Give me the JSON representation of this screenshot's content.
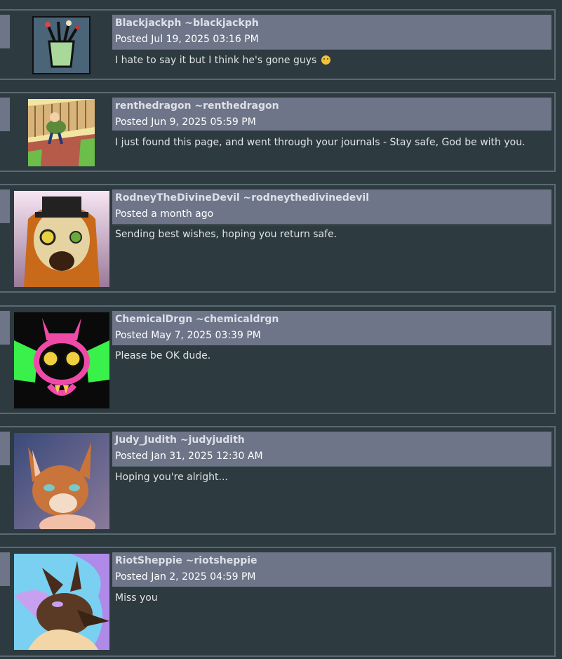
{
  "comments": [
    {
      "display_name": "Blackjackph",
      "username": "~blackjackph",
      "posted": "Posted Jul 19, 2025 03:16 PM",
      "text": "I hate to say it but I think he's gone guys",
      "avatar_icon": "paintbrush-cup-avatar"
    },
    {
      "display_name": "renthedragon",
      "username": "~renthedragon",
      "posted": "Posted Jun 9, 2025 05:59 PM",
      "text": "I just found this page, and went through your journals - Stay safe, God be with you.",
      "avatar_icon": "cartoon-character-avatar"
    },
    {
      "display_name": "RodneyTheDivineDevil",
      "username": "~rodneythedivinedevil",
      "posted": "Posted a month ago",
      "text": "Sending best wishes, hoping you return safe.",
      "avatar_icon": "tophat-creature-avatar"
    },
    {
      "display_name": "ChemicalDrgn",
      "username": "~chemicaldrgn",
      "posted": "Posted May 7, 2025 03:39 PM",
      "text": "Please be OK dude.",
      "avatar_icon": "neon-dragon-avatar"
    },
    {
      "display_name": "Judy_Judith",
      "username": "~judyjudith",
      "posted": "Posted Jan 31, 2025 12:30 AM",
      "text": "Hoping you're alright...",
      "avatar_icon": "fox-avatar"
    },
    {
      "display_name": "RiotSheppie",
      "username": "~riotsheppie",
      "posted": "Posted Jan 2, 2025 04:59 PM",
      "text": "Miss you",
      "avatar_icon": "shepherd-dog-avatar"
    }
  ]
}
